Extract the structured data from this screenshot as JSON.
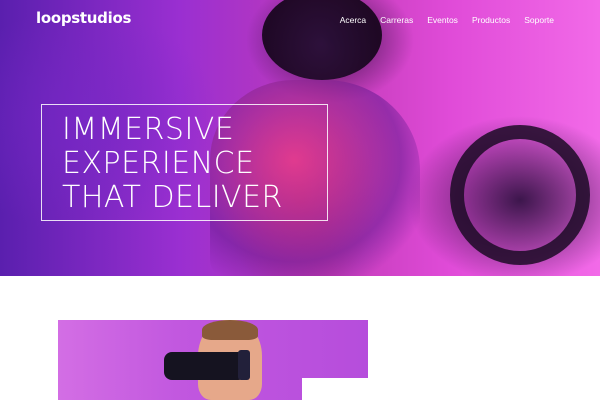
{
  "brand": {
    "logo_text": "loopstudios"
  },
  "nav": {
    "items": [
      {
        "label": "Acerca"
      },
      {
        "label": "Carreras"
      },
      {
        "label": "Eventos"
      },
      {
        "label": "Productos"
      },
      {
        "label": "Soporte"
      }
    ]
  },
  "hero": {
    "headline_lines": [
      "IMMERSIVE",
      "EXPERIENCE",
      "THAT DELIVER"
    ]
  },
  "colors": {
    "hero_purple": "#9a2fd1",
    "hero_pink": "#e04bd8",
    "text_white": "#ffffff",
    "page_background": "#ffffff"
  },
  "icons": []
}
